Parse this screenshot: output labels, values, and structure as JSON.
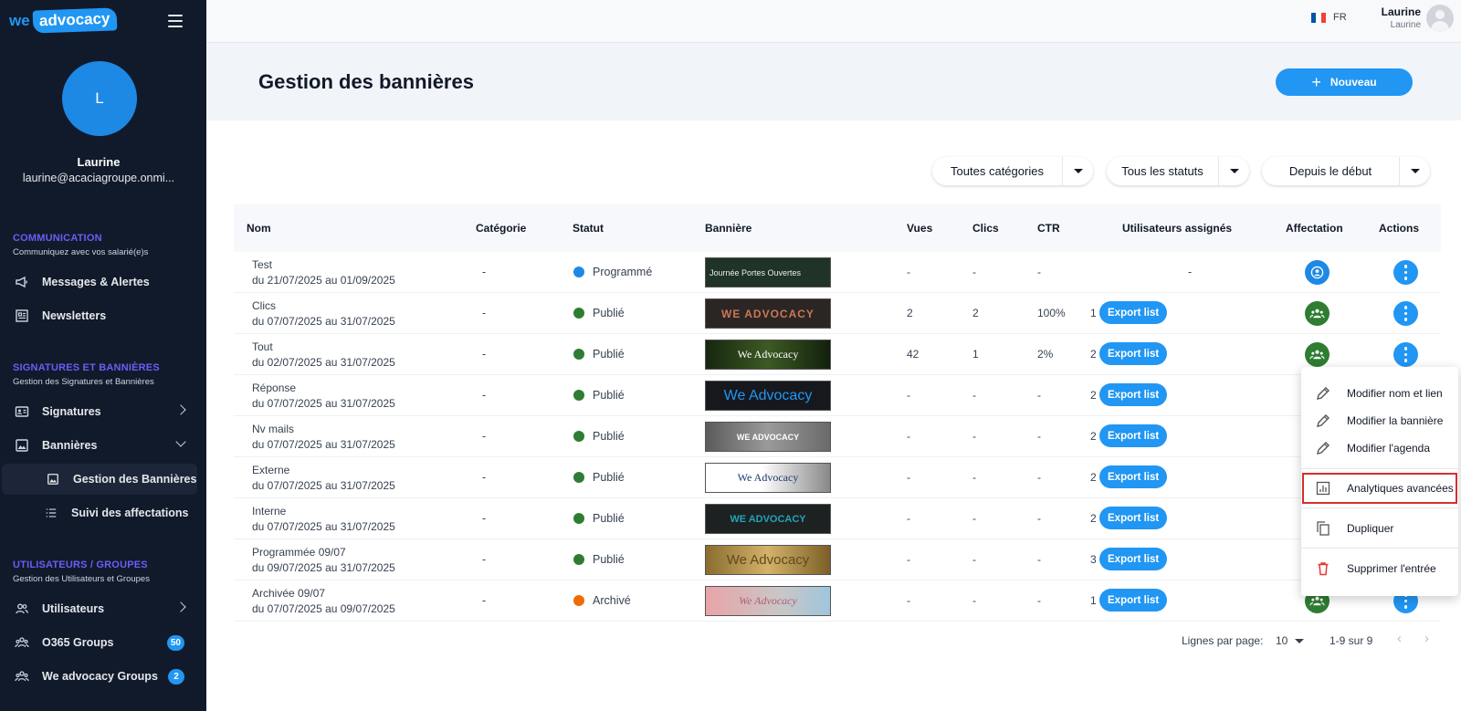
{
  "brand": {
    "we": "we",
    "advocacy": "advocacy"
  },
  "profile": {
    "initial": "L",
    "name": "Laurine",
    "email": "laurine@acaciagroupe.onmi..."
  },
  "sections": {
    "communication": {
      "title": "COMMUNICATION",
      "subtitle": "Communiquez avec vos salarié(e)s"
    },
    "signatures": {
      "title": "SIGNATURES ET BANNIÈRES",
      "subtitle": "Gestion des Signatures et Bannières"
    },
    "users": {
      "title": "UTILISATEURS / GROUPES",
      "subtitle": "Gestion des Utilisateurs et Groupes"
    }
  },
  "nav": {
    "messages": "Messages & Alertes",
    "newsletters": "Newsletters",
    "signatures": "Signatures",
    "bannieres": "Bannières",
    "gestion_bannieres": "Gestion des Bannières",
    "suivi_affectations": "Suivi des affectations",
    "utilisateurs": "Utilisateurs",
    "o365_groups": "O365 Groups",
    "o365_badge": "50",
    "we_groups": "We advocacy Groups",
    "we_groups_badge": "2"
  },
  "topbar": {
    "lang": "FR",
    "user_name": "Laurine",
    "user_sub": "Laurine"
  },
  "page": {
    "title": "Gestion des bannières",
    "new_button": "Nouveau"
  },
  "filters": {
    "category": "Toutes catégories",
    "status": "Tous les statuts",
    "period": "Depuis le début"
  },
  "table": {
    "headers": [
      "Nom",
      "Catégorie",
      "Statut",
      "Bannière",
      "Vues",
      "Clics",
      "CTR",
      "Utilisateurs assignés",
      "Affectation",
      "Actions"
    ],
    "export_label": "Export list",
    "rows": [
      {
        "name": "Test",
        "dates": "du 21/07/2025 au 01/09/2025",
        "category": "-",
        "status": "Programmé",
        "status_color": "#1e88e5",
        "banner_text": "Journée Portes Ouvertes",
        "views": "-",
        "clicks": "-",
        "ctr": "-",
        "assigned": "-",
        "assign_type": "single"
      },
      {
        "name": "Clics",
        "dates": "du 07/07/2025 au 31/07/2025",
        "category": "-",
        "status": "Publié",
        "status_color": "#2e7d32",
        "banner_text": "WE ADVOCACY",
        "views": "2",
        "clicks": "2",
        "ctr": "100%",
        "assigned": "1",
        "assign_type": "group"
      },
      {
        "name": "Tout",
        "dates": "du 02/07/2025 au 31/07/2025",
        "category": "-",
        "status": "Publié",
        "status_color": "#2e7d32",
        "banner_text": "We Advocacy",
        "views": "42",
        "clicks": "1",
        "ctr": "2%",
        "assigned": "2",
        "assign_type": "group"
      },
      {
        "name": "Réponse",
        "dates": "du 07/07/2025 au 31/07/2025",
        "category": "-",
        "status": "Publié",
        "status_color": "#2e7d32",
        "banner_text": "We Advocacy",
        "views": "-",
        "clicks": "-",
        "ctr": "-",
        "assigned": "2",
        "assign_type": "group"
      },
      {
        "name": "Nv mails",
        "dates": "du 07/07/2025 au 31/07/2025",
        "category": "-",
        "status": "Publié",
        "status_color": "#2e7d32",
        "banner_text": "WE ADVOCACY",
        "views": "-",
        "clicks": "-",
        "ctr": "-",
        "assigned": "2",
        "assign_type": "group"
      },
      {
        "name": "Externe",
        "dates": "du 07/07/2025 au 31/07/2025",
        "category": "-",
        "status": "Publié",
        "status_color": "#2e7d32",
        "banner_text": "We Advocacy",
        "views": "-",
        "clicks": "-",
        "ctr": "-",
        "assigned": "2",
        "assign_type": "group"
      },
      {
        "name": "Interne",
        "dates": "du 07/07/2025 au 31/07/2025",
        "category": "-",
        "status": "Publié",
        "status_color": "#2e7d32",
        "banner_text": "WE ADVOCACY",
        "views": "-",
        "clicks": "-",
        "ctr": "-",
        "assigned": "2",
        "assign_type": "group"
      },
      {
        "name": "Programmée 09/07",
        "dates": "du 09/07/2025 au 31/07/2025",
        "category": "-",
        "status": "Publié",
        "status_color": "#2e7d32",
        "banner_text": "We Advocacy",
        "views": "-",
        "clicks": "-",
        "ctr": "-",
        "assigned": "3",
        "assign_type": "group"
      },
      {
        "name": "Archivée 09/07",
        "dates": "du 07/07/2025 au 09/07/2025",
        "category": "-",
        "status": "Archivé",
        "status_color": "#ef6c00",
        "banner_text": "We Advocacy",
        "views": "-",
        "clicks": "-",
        "ctr": "-",
        "assigned": "1",
        "assign_type": "group"
      }
    ]
  },
  "pagination": {
    "rows_label": "Lignes par page:",
    "rows_value": "10",
    "range": "1-9 sur 9"
  },
  "context_menu": {
    "edit_name": "Modifier nom et lien",
    "edit_banner": "Modifier la bannière",
    "edit_agenda": "Modifier l'agenda",
    "analytics": "Analytiques avancées",
    "duplicate": "Dupliquer",
    "delete": "Supprimer l'entrée"
  },
  "colors": {
    "primary": "#2196f3",
    "sidebar": "#111a2b",
    "section_title": "#6d5cf6",
    "assign_green": "#2e7d32",
    "highlight_red": "#d32f2f"
  }
}
